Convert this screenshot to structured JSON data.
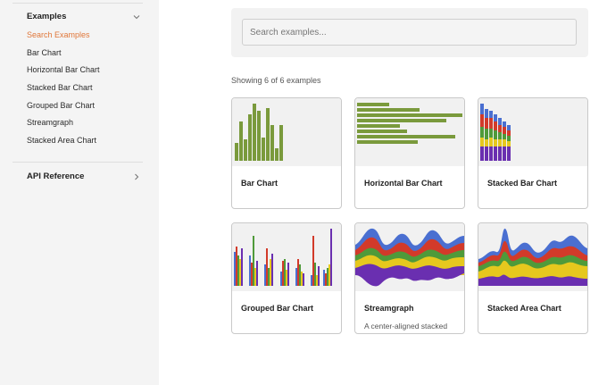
{
  "sidebar": {
    "examples_heading": "Examples",
    "items": [
      {
        "label": "Search Examples",
        "active": true
      },
      {
        "label": "Bar Chart",
        "active": false
      },
      {
        "label": "Horizontal Bar Chart",
        "active": false
      },
      {
        "label": "Stacked Bar Chart",
        "active": false
      },
      {
        "label": "Grouped Bar Chart",
        "active": false
      },
      {
        "label": "Streamgraph",
        "active": false
      },
      {
        "label": "Stacked Area Chart",
        "active": false
      }
    ],
    "api_heading": "API Reference",
    "icons": {
      "examples_toggle": "chevron-down-icon",
      "api_toggle": "chevron-right-icon"
    }
  },
  "search": {
    "placeholder": "Search examples...",
    "value": ""
  },
  "results": {
    "count_text": "Showing 6 of 6 examples"
  },
  "cards": [
    {
      "title": "Bar Chart",
      "description": ""
    },
    {
      "title": "Horizontal Bar Chart",
      "description": ""
    },
    {
      "title": "Stacked Bar Chart",
      "description": ""
    },
    {
      "title": "Grouped Bar Chart",
      "description": ""
    },
    {
      "title": "Streamgraph",
      "description": "A center-aligned stacked area chart"
    },
    {
      "title": "Stacked Area Chart",
      "description": ""
    }
  ],
  "colors": {
    "accent_active": "#e0773a",
    "bar_green": "#7a9a3c",
    "series": [
      "#4a6fd1",
      "#d23a2a",
      "#4f9a3a",
      "#e6c81e",
      "#6a2fb0"
    ]
  }
}
